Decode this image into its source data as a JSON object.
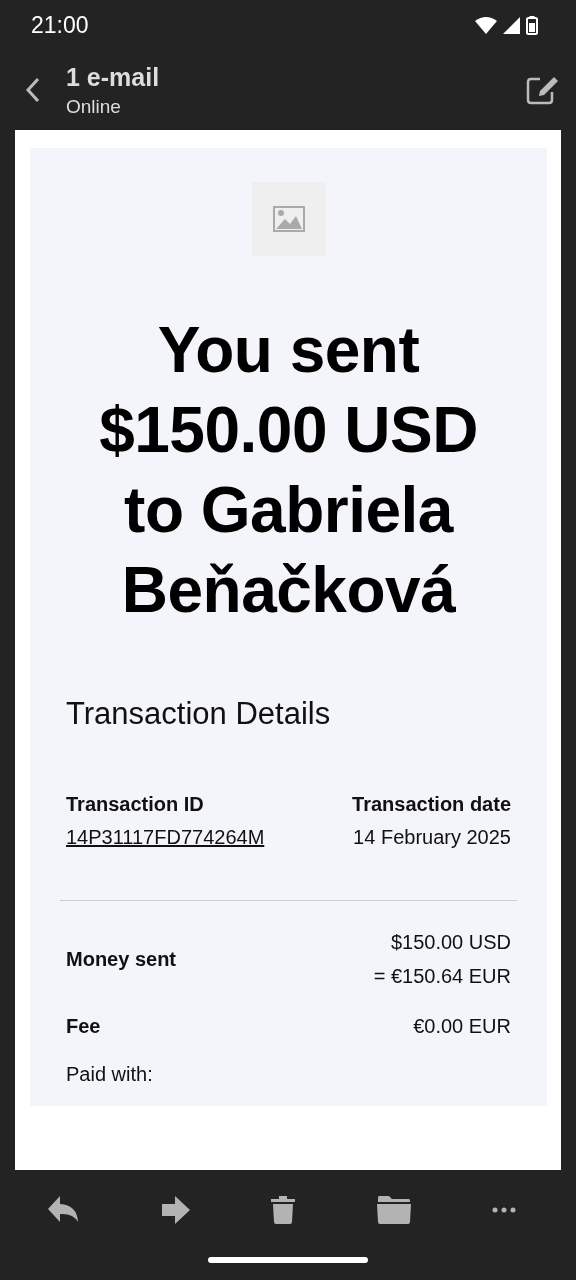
{
  "status_bar": {
    "time": "21:00"
  },
  "app_bar": {
    "title": "1 e-mail",
    "subtitle": "Online"
  },
  "email": {
    "headline": "You sent $150.00 USD to Gabriela Beňačková",
    "section_title": "Transaction Details",
    "transaction_id": {
      "label": "Transaction ID",
      "value": "14P31117FD774264M"
    },
    "transaction_date": {
      "label": "Transaction date",
      "value": "14 February 2025"
    },
    "rows": [
      {
        "label": "Money sent",
        "values": [
          "$150.00 USD",
          "= €150.64 EUR"
        ]
      },
      {
        "label": "Fee",
        "values": [
          "€0.00 EUR"
        ]
      }
    ],
    "paid_with": "Paid with:"
  }
}
